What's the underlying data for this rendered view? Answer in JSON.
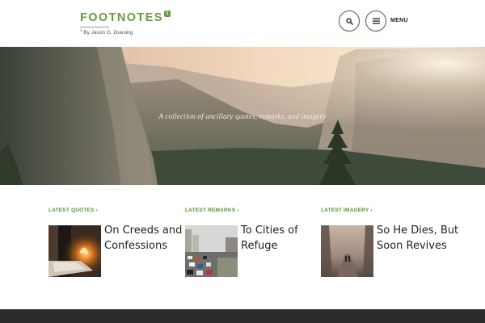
{
  "site": {
    "title": "FOOTNOTES",
    "superscript": "1",
    "byline_sup": "1",
    "byline": "By Jason G. Duesing"
  },
  "header": {
    "menu_label": "MENU",
    "search_icon": "search-icon",
    "menu_icon": "hamburger-icon"
  },
  "hero": {
    "tagline": "A collection of ancillary quotes, remarks, and imagery"
  },
  "sections": [
    {
      "label": "LATEST QUOTES ›",
      "post_title": "On Creeds and Confessions",
      "thumb": "fireplace-book-photo"
    },
    {
      "label": "LATEST REMARKS ›",
      "post_title": "To Cities of Refuge",
      "thumb": "city-traffic-photo"
    },
    {
      "label": "LATEST IMAGERY ›",
      "post_title": "So He Dies, But Soon Revives",
      "thumb": "foggy-path-photo"
    }
  ],
  "colors": {
    "accent": "#6a9a3a",
    "footer": "#2a2a2a"
  }
}
